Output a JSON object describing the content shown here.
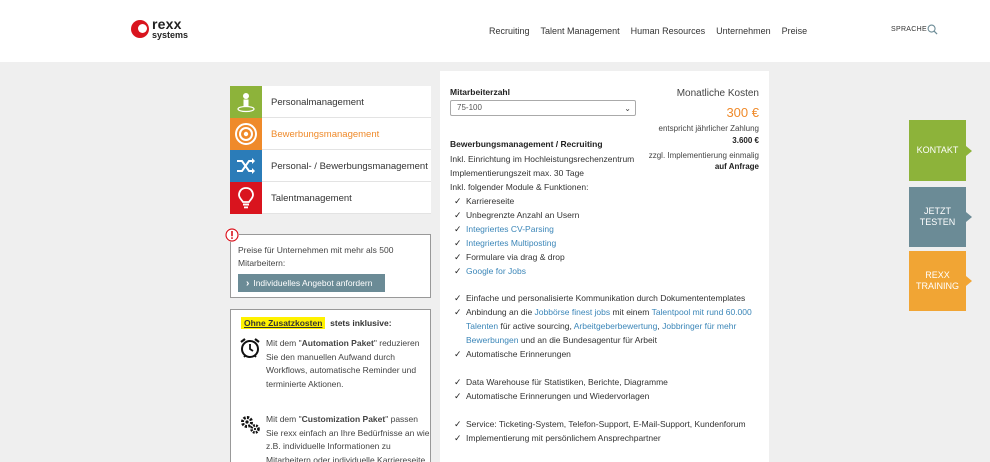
{
  "header": {
    "logo_line1": "rexx",
    "logo_line2": "systems",
    "nav": [
      "Recruiting",
      "Talent Management",
      "Human Resources",
      "Unternehmen",
      "Preise"
    ],
    "language_label": "SPRACHE"
  },
  "categories": [
    {
      "label": "Personalmanagement",
      "icon": "person-icon",
      "color": "#8db33a"
    },
    {
      "label": "Bewerbungsmanagement",
      "icon": "target-icon",
      "color": "#ef8a2a"
    },
    {
      "label": "Personal- / Bewerbungsmanagement",
      "icon": "shuffle-icon",
      "color": "#2b7cb8"
    },
    {
      "label": "Talentmanagement",
      "icon": "lightbulb-icon",
      "color": "#d9141e"
    }
  ],
  "info_box": {
    "text": "Preise für Unternehmen mit mehr als 500 Mitarbeitern:",
    "button_label": "Individuelles Angebot anfordern"
  },
  "extras": {
    "heading_highlight": "Ohne Zusatzkosten",
    "heading_rest": "stets inklusive:",
    "items": [
      {
        "icon": "alarm-clock-icon",
        "pre": "Mit dem \"",
        "bold": "Automation Paket",
        "post": "\" reduzieren Sie den manuellen Aufwand durch Workflows, automatische Reminder und terminierte Aktionen."
      },
      {
        "icon": "gears-icon",
        "pre": "Mit dem \"",
        "bold": "Customization Paket",
        "post": "\" passen Sie rexx einfach an Ihre Bedürfnisse an wie z.B. individuelle Informationen zu Mitarbeitern oder individuelle Karriereseite"
      }
    ]
  },
  "main": {
    "field_label": "Mitarbeiterzahl",
    "select_value": "75-100",
    "cost_title": "Monatliche Kosten",
    "cost_value": "300 €",
    "cost_note": "entspricht jährlicher Zahlung",
    "cost_year": "3.600 €",
    "impl_note": "zzgl. Implementierung einmalig",
    "impl_value": "auf Anfrage",
    "block_title": "Bewerbungsmanagement / Recruiting",
    "info_lines": [
      "Inkl. Einrichtung im Hochleistungsrechenzentrum",
      "Implementierungszeit max. 30 Tage",
      "Inkl. folgender Module & Funktionen:"
    ],
    "group1": [
      {
        "t": "Karriereseite"
      },
      {
        "t": "Unbegrenzte Anzahl an Usern"
      },
      {
        "t": "Integriertes CV-Parsing",
        "link": true
      },
      {
        "t": "Integriertes Multiposting",
        "link": true
      },
      {
        "t": "Formulare via drag & drop"
      },
      {
        "t": "Google for Jobs",
        "link": true
      }
    ],
    "group2_item1": "Einfache und personalisierte Kommunikation durch Dokumententemplates",
    "group2_item2": {
      "a": "Anbindung an die ",
      "b": "Jobbörse finest jobs",
      "c": " mit einem ",
      "d": "Talentpool mit rund 60.000 Talenten",
      "e": " für active sourcing, ",
      "f": "Arbeitgeberbewertung",
      "g": ", ",
      "h": "Jobbringer für mehr Bewerbungen",
      "i": " und an die Bundesagentur für Arbeit"
    },
    "group2_item3": "Automatische Erinnerungen",
    "group3": [
      "Data Warehouse für Statistiken, Berichte, Diagramme",
      "Automatische Erinnerungen und Wiedervorlagen"
    ],
    "group4": [
      "Service: Ticketing-System, Telefon-Support, E-Mail-Support, Kundenforum",
      "Implementierung mit persönlichem Ansprechpartner"
    ]
  },
  "side_buttons": {
    "kontakt": "KONTAKT",
    "testen_1": "JETZT",
    "testen_2": "TESTEN",
    "training_1": "REXX",
    "training_2": "TRAINING"
  },
  "colors": {
    "accent": "#ef8a2a",
    "green": "#8db33a",
    "slate": "#6b8b96",
    "orange": "#f1a534",
    "link": "#3b86b8"
  }
}
